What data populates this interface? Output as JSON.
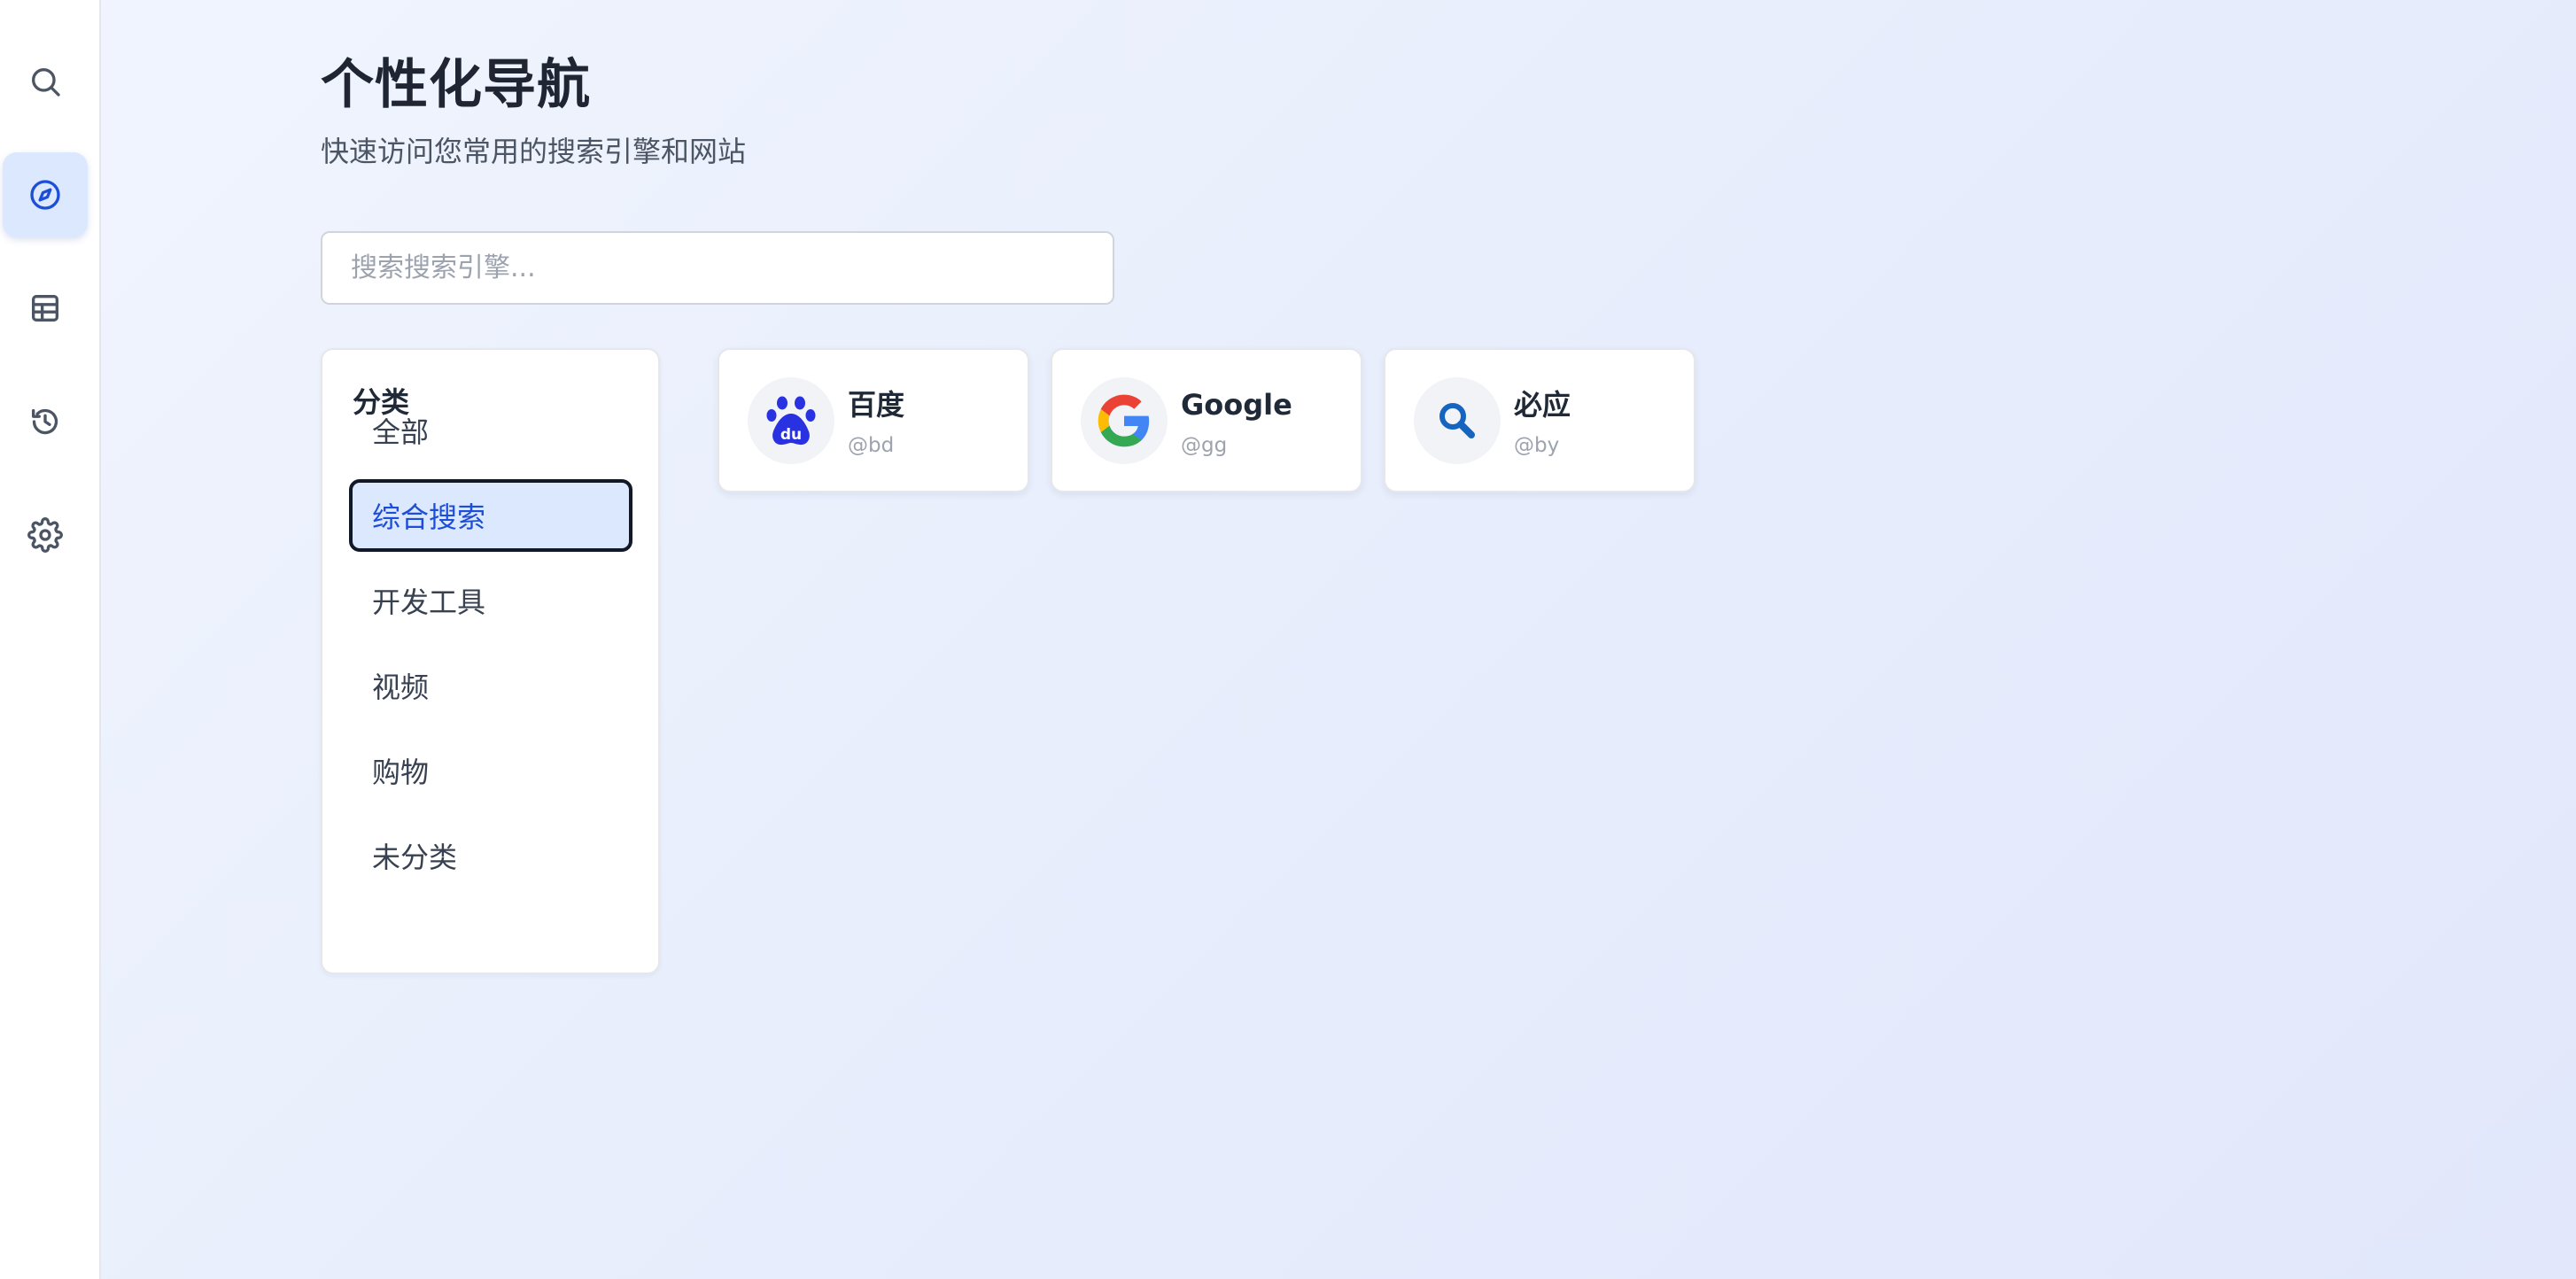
{
  "sidebar": {
    "items": [
      {
        "name": "search",
        "icon": "search-icon",
        "active": false
      },
      {
        "name": "navigation",
        "icon": "compass-icon",
        "active": true
      },
      {
        "name": "table",
        "icon": "table-icon",
        "active": false
      },
      {
        "name": "history",
        "icon": "history-icon",
        "active": false
      },
      {
        "name": "settings",
        "icon": "gear-icon",
        "active": false
      }
    ]
  },
  "header": {
    "title": "个性化导航",
    "subtitle": "快速访问您常用的搜索引擎和网站"
  },
  "search": {
    "placeholder": "搜索搜索引擎...",
    "value": ""
  },
  "categories": {
    "heading": "分类",
    "items": [
      {
        "label": "全部",
        "active": false
      },
      {
        "label": "综合搜索",
        "active": true
      },
      {
        "label": "开发工具",
        "active": false
      },
      {
        "label": "视频",
        "active": false
      },
      {
        "label": "购物",
        "active": false
      },
      {
        "label": "未分类",
        "active": false
      }
    ]
  },
  "engines": [
    {
      "name": "百度",
      "alias": "@bd",
      "icon": "baidu-paw-icon",
      "color": "#2932e1"
    },
    {
      "name": "Google",
      "alias": "@gg",
      "icon": "google-g-icon",
      "color": "#4285f4"
    },
    {
      "name": "必应",
      "alias": "@by",
      "icon": "magnifier-icon",
      "color": "#1565c0"
    }
  ],
  "colors": {
    "accent": "#1d4ed8",
    "active_bg": "#dbe8fd"
  }
}
